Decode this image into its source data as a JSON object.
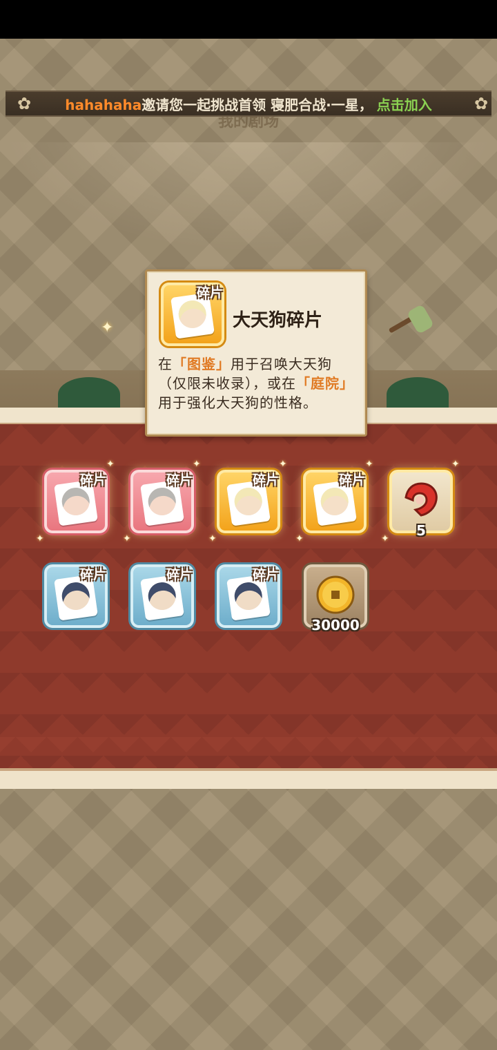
{
  "banner": {
    "player_name": "hahahaha",
    "message": "邀请您一起挑战首领 寝肥合战·一星，",
    "join_label": "点击加入"
  },
  "stage": {
    "title": "我的剧场"
  },
  "tooltip": {
    "icon_label": "碎片",
    "title": "大天狗碎片",
    "desc_parts": [
      "在",
      "「图鉴」",
      "用于召唤大天狗（仅限未收录），或在",
      "「庭院」",
      "用于强化大天狗的性格。"
    ]
  },
  "rewards": {
    "row1": [
      {
        "label": "碎片",
        "rarity": "red"
      },
      {
        "label": "碎片",
        "rarity": "red"
      },
      {
        "label": "碎片",
        "rarity": "gold"
      },
      {
        "label": "碎片",
        "rarity": "gold"
      },
      {
        "label": "",
        "rarity": "gold",
        "icon": "red-magatama-icon",
        "quantity": "5"
      }
    ],
    "row2": [
      {
        "label": "碎片",
        "rarity": "blue"
      },
      {
        "label": "碎片",
        "rarity": "blue"
      },
      {
        "label": "碎片",
        "rarity": "blue"
      },
      {
        "label": "",
        "rarity": "bronze",
        "icon": "gold-coin-icon",
        "quantity": "30000"
      }
    ]
  },
  "colors": {
    "highlight": "#e07a23",
    "panel_red": "#8f3a2c",
    "player_name": "#ff8a2a",
    "join": "#8bd152"
  }
}
